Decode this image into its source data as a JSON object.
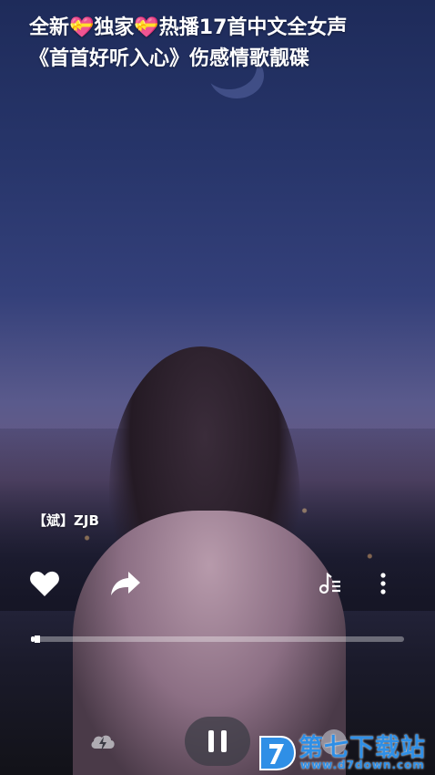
{
  "video": {
    "title_line1": "全新💝独家💝热播17首中文全女声",
    "title_line2": "《首首好听入心》伤感情歌靓碟",
    "artist": "【斌】ZJB"
  },
  "actions": {
    "like_icon": "heart-icon",
    "share_icon": "share-arrow-icon",
    "playlist_icon": "music-list-icon",
    "more_icon": "more-vertical-icon"
  },
  "player": {
    "progress_fraction": 0.01,
    "state": "playing",
    "pause_icon": "pause-icon",
    "boost_icon": "lightning-bolt-icon"
  },
  "watermark": {
    "text": "第七下载站",
    "url": "www.d7down.com"
  },
  "colors": {
    "watermark": "#2f8fe6",
    "text": "#ffffff"
  }
}
